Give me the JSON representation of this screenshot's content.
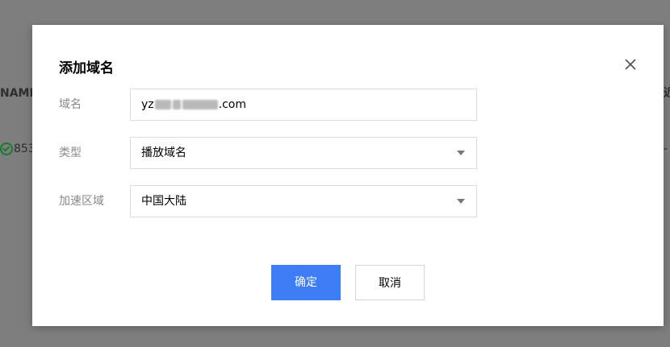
{
  "background": {
    "table_header_left": "NAMI",
    "table_header_right": "近",
    "row_status_value": "853",
    "row_right_value": "-"
  },
  "dialog": {
    "title": "添加域名",
    "close_icon": "close-icon",
    "fields": {
      "domain": {
        "label": "域名",
        "value_prefix": "yz",
        "value_suffix": ".com",
        "note": "partially blurred in screenshot"
      },
      "type": {
        "label": "类型",
        "value": "播放域名"
      },
      "region": {
        "label": "加速区域",
        "value": "中国大陆"
      }
    },
    "buttons": {
      "confirm": "确定",
      "cancel": "取消"
    }
  },
  "colors": {
    "primary": "#3e7df6",
    "overlay": "#7e7e7e",
    "success": "#1a7a2f"
  }
}
